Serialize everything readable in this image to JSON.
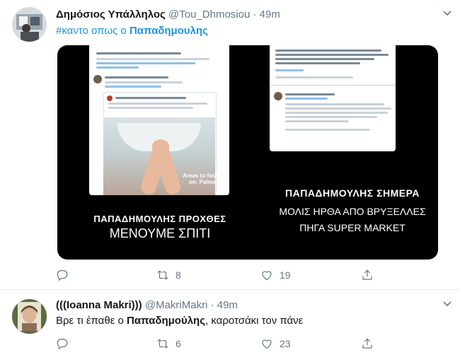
{
  "tweets": [
    {
      "author": "Δημόσιος Υπάλληλος",
      "handle": "@Tou_Dhmosiou",
      "separator": "·",
      "time": "49m",
      "hashtag_text": "#καντο οπως ο ",
      "hashtag_bold": "Παπαδημουλης",
      "media": {
        "left_caption_line1": "ΠΑΠΑΔΗΜΟΥΛΗΣ ΠΡΟΧΘΕΣ",
        "left_caption_line2": "ΜΕΝΟΥΜΕ ΣΠΙΤΙ",
        "right_caption_line1": "ΠΑΠΑΔΗΜΟΥΛΗΣ ΣΗΜΕΡΑ",
        "right_caption_line2": "ΜΟΛΙΣ ΗΡΘΑ ΑΠΟ ΒΡΥΞΕΛΛΕΣ",
        "right_caption_line3": "ΠΗΓΑ SUPER MARKET",
        "video_caption": "Areas to focus on: Palms"
      },
      "actions": {
        "replies": "",
        "retweets": "8",
        "likes": "19"
      }
    },
    {
      "author": "(((Ioanna Makri)))",
      "handle": "@MakriMakri",
      "separator": "·",
      "time": "49m",
      "text_before": "Βρε τι έπαθε ο ",
      "text_bold": "Παπαδημούλης",
      "text_after": ", καροτσάκι τον πάνε",
      "actions": {
        "replies": "",
        "retweets": "6",
        "likes": "23"
      }
    }
  ],
  "colors": {
    "accent": "#1b95e0",
    "muted": "#657786",
    "text": "#14171a",
    "media_bg": "#000000"
  },
  "icons": [
    "chevron-down-icon",
    "reply-icon",
    "retweet-icon",
    "like-icon",
    "share-icon"
  ]
}
